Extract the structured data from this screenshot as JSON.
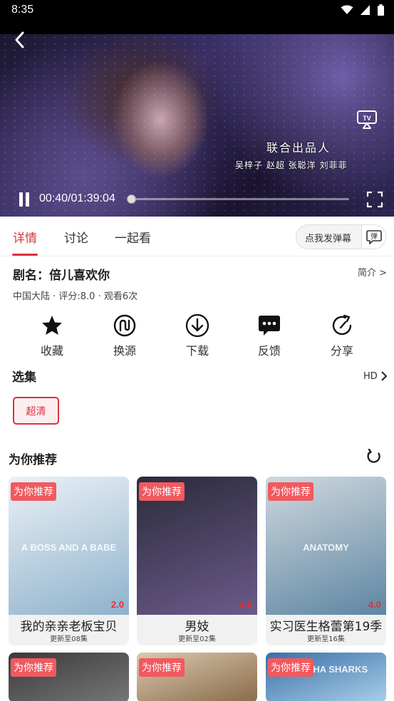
{
  "status_bar": {
    "time": "8:35",
    "icons": [
      "wifi-icon",
      "signal-icon",
      "battery-icon"
    ]
  },
  "player": {
    "subtitle_line1": "联合出品人",
    "subtitle_line2": "吴梓子  赵超  张聪洋  刘菲菲",
    "time_display": "00:40/01:39:04",
    "progress": 0.0067,
    "icons": {
      "back": "back-arrow-icon",
      "cast": "tv-cast-icon",
      "pause": "pause-icon",
      "fullscreen": "fullscreen-icon"
    }
  },
  "tabs": [
    {
      "label": "详情",
      "active": true
    },
    {
      "label": "讨论",
      "active": false
    },
    {
      "label": "一起看",
      "active": false
    }
  ],
  "danmaku": {
    "label": "点我发弹幕",
    "icon_char": "弹"
  },
  "show": {
    "title": "剧名：倍儿喜欢你",
    "intro_link": "简介 >",
    "meta": "中国大陆 · 评分:8.0 · 观看6次"
  },
  "actions": [
    {
      "label": "收藏",
      "icon": "star-icon"
    },
    {
      "label": "换源",
      "icon": "switch-source-icon"
    },
    {
      "label": "下载",
      "icon": "download-icon"
    },
    {
      "label": "反馈",
      "icon": "feedback-icon"
    },
    {
      "label": "分享",
      "icon": "share-icon"
    }
  ],
  "episodes": {
    "title": "选集",
    "quality_link": "HD",
    "quality_option": "超清"
  },
  "recommend": {
    "title": "为你推荐",
    "badge": "为你推荐",
    "items": [
      {
        "name": "我的亲亲老板宝贝",
        "update": "更新至08集",
        "score": "2.0",
        "poster_text": "A BOSS AND A BABE",
        "colors": [
          "#eaf1f6",
          "#8fb2cc"
        ]
      },
      {
        "name": "男妓",
        "update": "更新至02集",
        "score": "4.0",
        "poster_text": "",
        "colors": [
          "#2b2b3b",
          "#6b5a8a"
        ]
      },
      {
        "name": "实习医生格蕾第19季",
        "update": "更新至16集",
        "score": "4.0",
        "poster_text": "ANATOMY",
        "colors": [
          "#cfd8de",
          "#5f86a3"
        ]
      },
      {
        "name": "",
        "update": "",
        "score": "",
        "poster_text": "",
        "colors": [
          "#3a3a3a",
          "#777"
        ]
      },
      {
        "name": "",
        "update": "",
        "score": "",
        "poster_text": "",
        "colors": [
          "#d9c9b0",
          "#8a6a4a"
        ]
      },
      {
        "name": "",
        "update": "",
        "score": "",
        "poster_text": "PIRANHA SHARKS",
        "colors": [
          "#3a6fa8",
          "#a8cfe8"
        ]
      }
    ]
  }
}
